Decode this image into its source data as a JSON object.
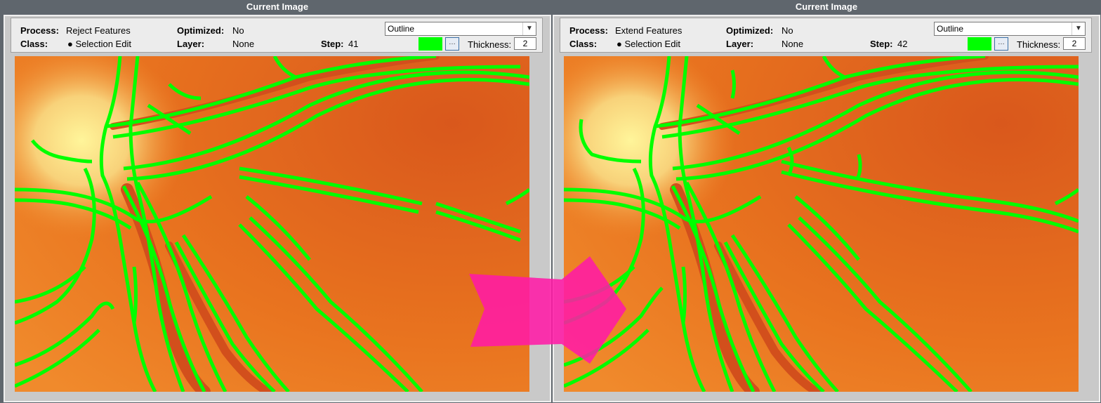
{
  "left": {
    "title": "Current Image",
    "process_label": "Process:",
    "process_value": "Reject Features",
    "optimized_label": "Optimized:",
    "optimized_value": "No",
    "class_label": "Class:",
    "class_value": "● Selection Edit",
    "layer_label": "Layer:",
    "layer_value": "None",
    "step_label": "Step:",
    "step_value": "41",
    "display_mode": "Outline",
    "thickness_label": "Thickness:",
    "thickness_value": "2"
  },
  "right": {
    "title": "Current Image",
    "process_label": "Process:",
    "process_value": "Extend Features",
    "optimized_label": "Optimized:",
    "optimized_value": "No",
    "class_label": "Class:",
    "class_value": "● Selection Edit",
    "layer_label": "Layer:",
    "layer_value": "None",
    "step_label": "Step:",
    "step_value": "42",
    "display_mode": "Outline",
    "thickness_label": "Thickness:",
    "thickness_value": "2"
  },
  "colors": {
    "outline": "#00ff00",
    "arrow": "#ff1aa6",
    "background": "#5f666d"
  },
  "icons": {
    "dropdown": "chevron-down-icon",
    "color_picker": "ellipsis-icon",
    "transition": "right-arrow-icon"
  }
}
